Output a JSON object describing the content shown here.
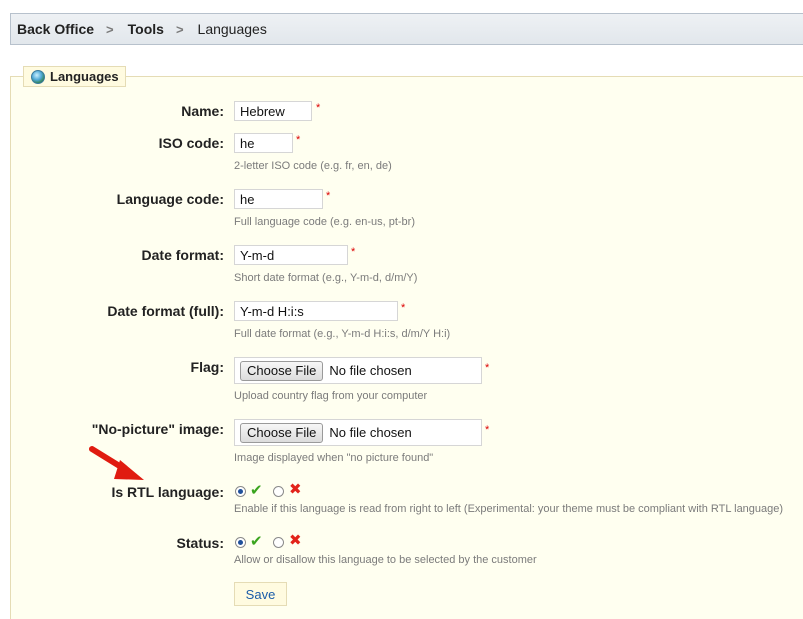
{
  "breadcrumb": {
    "items": [
      "Back Office",
      "Tools",
      "Languages"
    ],
    "separator": ">"
  },
  "panel": {
    "title": "Languages"
  },
  "form": {
    "name": {
      "label": "Name:",
      "value": "Hebrew",
      "required": "*"
    },
    "iso": {
      "label": "ISO code:",
      "value": "he",
      "required": "*",
      "hint": "2-letter ISO code (e.g. fr, en, de)"
    },
    "langcode": {
      "label": "Language code:",
      "value": "he",
      "required": "*",
      "hint": "Full language code (e.g. en-us, pt-br)"
    },
    "date": {
      "label": "Date format:",
      "value": "Y-m-d",
      "required": "*",
      "hint": "Short date format (e.g., Y-m-d, d/m/Y)"
    },
    "datefull": {
      "label": "Date format (full):",
      "value": "Y-m-d H:i:s",
      "required": "*",
      "hint": "Full date format (e.g., Y-m-d H:i:s, d/m/Y H:i)"
    },
    "flag": {
      "label": "Flag:",
      "button": "Choose File",
      "status": "No file chosen",
      "required": "*",
      "hint": "Upload country flag from your computer"
    },
    "nopic": {
      "label": "\"No-picture\" image:",
      "button": "Choose File",
      "status": "No file chosen",
      "required": "*",
      "hint": "Image displayed when \"no picture found\""
    },
    "rtl": {
      "label": "Is RTL language:",
      "selected": "yes",
      "hint": "Enable if this language is read from right to left (Experimental: your theme must be compliant with RTL language)"
    },
    "status": {
      "label": "Status:",
      "selected": "yes",
      "hint": "Allow or disallow this language to be selected by the customer"
    },
    "save_label": "Save"
  },
  "icons": {
    "yes": "check-icon",
    "no": "cross-icon"
  },
  "colors": {
    "panel_bg": "#fffff0",
    "accent_link": "#1a5ca8",
    "required": "#dd0000",
    "yes": "#3aa41e",
    "no": "#e2231a"
  }
}
